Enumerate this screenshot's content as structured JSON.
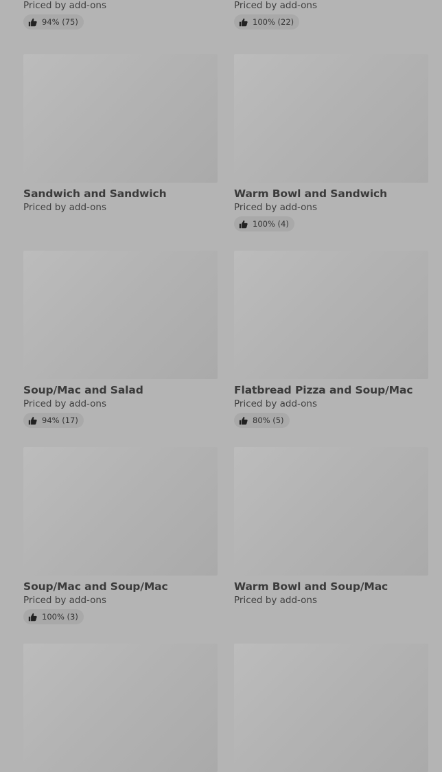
{
  "items": [
    {
      "name": "",
      "price": "Priced by add-ons",
      "rating": "94% (75)"
    },
    {
      "name": "",
      "price": "Priced by add-ons",
      "rating": "100% (22)"
    },
    {
      "name": "Sandwich and Sandwich",
      "price": "Priced by add-ons",
      "rating": ""
    },
    {
      "name": "Warm Bowl and Sandwich",
      "price": "Priced by add-ons",
      "rating": "100% (4)"
    },
    {
      "name": "Soup/Mac and Salad",
      "price": "Priced by add-ons",
      "rating": "94% (17)"
    },
    {
      "name": "Flatbread Pizza and Soup/Mac",
      "price": "Priced by add-ons",
      "rating": "80% (5)"
    },
    {
      "name": "Soup/Mac and Soup/Mac",
      "price": "Priced by add-ons",
      "rating": "100% (3)"
    },
    {
      "name": "Warm Bowl and Soup/Mac",
      "price": "Priced by add-ons",
      "rating": ""
    },
    {
      "name": "",
      "price": "",
      "rating": ""
    },
    {
      "name": "",
      "price": "",
      "rating": ""
    }
  ],
  "icons": {
    "rating": "thumbs-up-icon"
  }
}
